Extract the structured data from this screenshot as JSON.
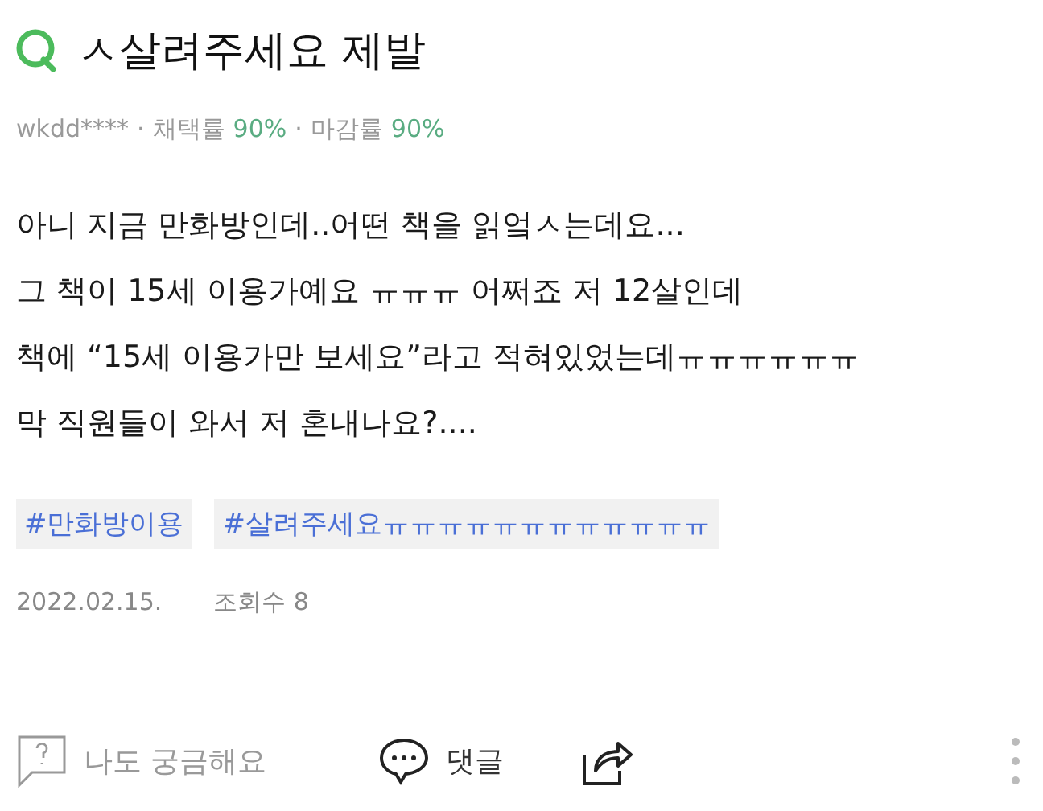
{
  "question": {
    "title": "ㅅ살려주세요 제발"
  },
  "meta": {
    "user": "wkdd****",
    "separator": "·",
    "stats": [
      {
        "label": "채택률",
        "value": "90%"
      },
      {
        "label": "마감률",
        "value": "90%"
      }
    ]
  },
  "body": [
    "아니 지금 만화방인데..어떤 책을 읽엌ㅅ는데요...",
    "그 책이 15세 이용가예요 ㅠㅠㅠ 어쩌죠 저 12살인데",
    "책에 “15세 이용가만 보세요”라고 적혀있었는데ㅠㅠㅠㅠㅠㅠ",
    "막 직원들이 와서 저 혼내나요?...."
  ],
  "tags": [
    "#만화방이용",
    "#살려주세요ㅠㅠㅠㅠㅠㅠㅠㅠㅠㅠㅠㅠ"
  ],
  "info": {
    "date": "2022.02.15.",
    "views": "조회수 8"
  },
  "actions": [
    {
      "kind": "curious",
      "label": "나도 궁금해요"
    },
    {
      "kind": "comment",
      "label": "댓글"
    },
    {
      "kind": "share"
    },
    {
      "kind": "more"
    }
  ]
}
